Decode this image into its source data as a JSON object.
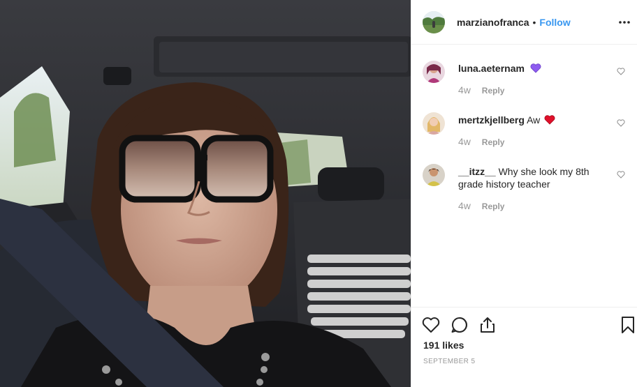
{
  "post": {
    "username": "marzianofranca",
    "separator": "•",
    "follow_label": "Follow",
    "more_icon": "more-options-icon",
    "photo_description_icon": "post-photo"
  },
  "comments": [
    {
      "username": "luna.aeternam",
      "text": "",
      "emoji": "purple-heart",
      "age": "4w",
      "reply_label": "Reply"
    },
    {
      "username": "mertzkjellberg",
      "text": "Aw",
      "emoji": "red-heart",
      "age": "4w",
      "reply_label": "Reply"
    },
    {
      "username": "__itzz__",
      "text": "Why she look my 8th grade history teacher",
      "emoji": "",
      "age": "4w",
      "reply_label": "Reply"
    }
  ],
  "actions": {
    "likes": "191 likes",
    "date": "SEPTEMBER 5"
  },
  "colors": {
    "link_blue": "#3897f0",
    "secondary_text": "#999999",
    "primary_text": "#262626",
    "divider": "#efefef",
    "purple_heart": "#8e5cf0",
    "red_heart": "#e0102a"
  }
}
